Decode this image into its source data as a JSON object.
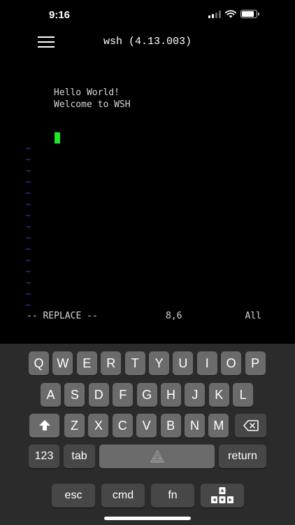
{
  "status_bar": {
    "time": "9:16"
  },
  "header": {
    "title": "wsh (4.13.003)"
  },
  "terminal": {
    "lines": [
      "Hello World!",
      "Welcome to WSH"
    ],
    "tilde": "~",
    "mode": "-- REPLACE --",
    "position": "8,6",
    "scroll": "All"
  },
  "keyboard": {
    "row1": [
      "Q",
      "W",
      "E",
      "R",
      "T",
      "Y",
      "U",
      "I",
      "O",
      "P"
    ],
    "row2": [
      "A",
      "S",
      "D",
      "F",
      "G",
      "H",
      "J",
      "K",
      "L"
    ],
    "row3": [
      "Z",
      "X",
      "C",
      "V",
      "B",
      "N",
      "M"
    ],
    "numbers_label": "123",
    "tab_label": "tab",
    "return_label": "return",
    "esc_label": "esc",
    "cmd_label": "cmd",
    "fn_label": "fn"
  },
  "colors": {
    "cursor": "#1ee82b",
    "tilde": "#3e43c9",
    "keyboard_bg": "#2b2b2b",
    "key_bg": "#6b6b6b",
    "fn_key_bg": "#474747"
  },
  "icons": {
    "menu": "hamburger-icon",
    "shift": "shift-arrow-icon",
    "backspace": "backspace-icon",
    "space": "logo-icon",
    "arrows": "arrow-keys-icon"
  }
}
